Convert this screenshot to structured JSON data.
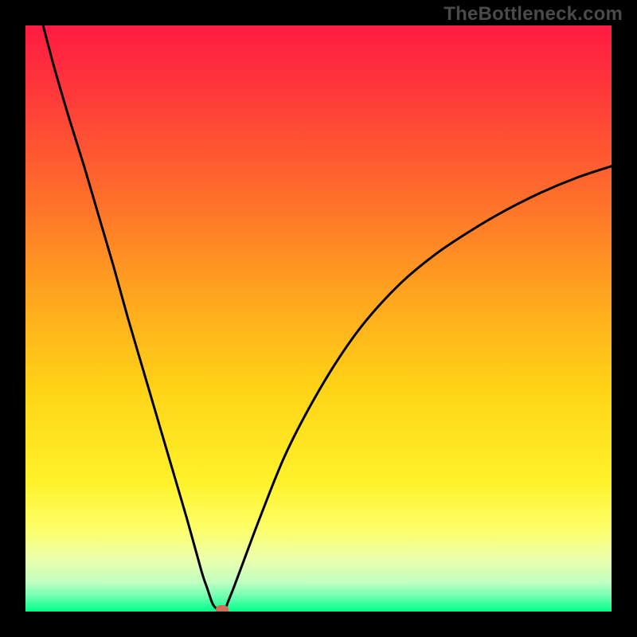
{
  "attribution": {
    "watermark": "TheBottleneck.com"
  },
  "chart_data": {
    "type": "line",
    "title": "",
    "xlabel": "",
    "ylabel": "",
    "xlim": [
      0,
      100
    ],
    "ylim": [
      0,
      100
    ],
    "background": {
      "type": "vertical-gradient",
      "stops": [
        {
          "pos": 0.0,
          "color": "#ff1a43"
        },
        {
          "pos": 0.12,
          "color": "#ff3a3a"
        },
        {
          "pos": 0.28,
          "color": "#ff6a2c"
        },
        {
          "pos": 0.45,
          "color": "#ffa21f"
        },
        {
          "pos": 0.62,
          "color": "#ffd316"
        },
        {
          "pos": 0.78,
          "color": "#fff22a"
        },
        {
          "pos": 0.86,
          "color": "#fdff6a"
        },
        {
          "pos": 0.91,
          "color": "#ecffac"
        },
        {
          "pos": 0.95,
          "color": "#c1ffc0"
        },
        {
          "pos": 0.975,
          "color": "#6affb0"
        },
        {
          "pos": 1.0,
          "color": "#00ff8a"
        }
      ]
    },
    "series": [
      {
        "name": "bottleneck-curve",
        "stroke": "#000000",
        "x": [
          3,
          5,
          7.5,
          10,
          12.5,
          15,
          17.5,
          20,
          22.5,
          25,
          27.5,
          30,
          31,
          32,
          33,
          34,
          34.5,
          35.5,
          37,
          40,
          44,
          48,
          53,
          58,
          64,
          70,
          76,
          82,
          88,
          94,
          100
        ],
        "y": [
          100,
          92.5,
          84,
          76,
          67.5,
          59,
          50,
          41.5,
          33,
          24.5,
          16,
          7,
          4,
          1.2,
          0.3,
          0.3,
          1.5,
          4,
          8,
          16,
          26,
          34,
          42.5,
          49.5,
          56,
          61,
          65,
          68.5,
          71.5,
          74,
          76
        ]
      }
    ],
    "marker": {
      "x": 33.5,
      "y": 0.3,
      "color": "#cf6f5b"
    }
  }
}
